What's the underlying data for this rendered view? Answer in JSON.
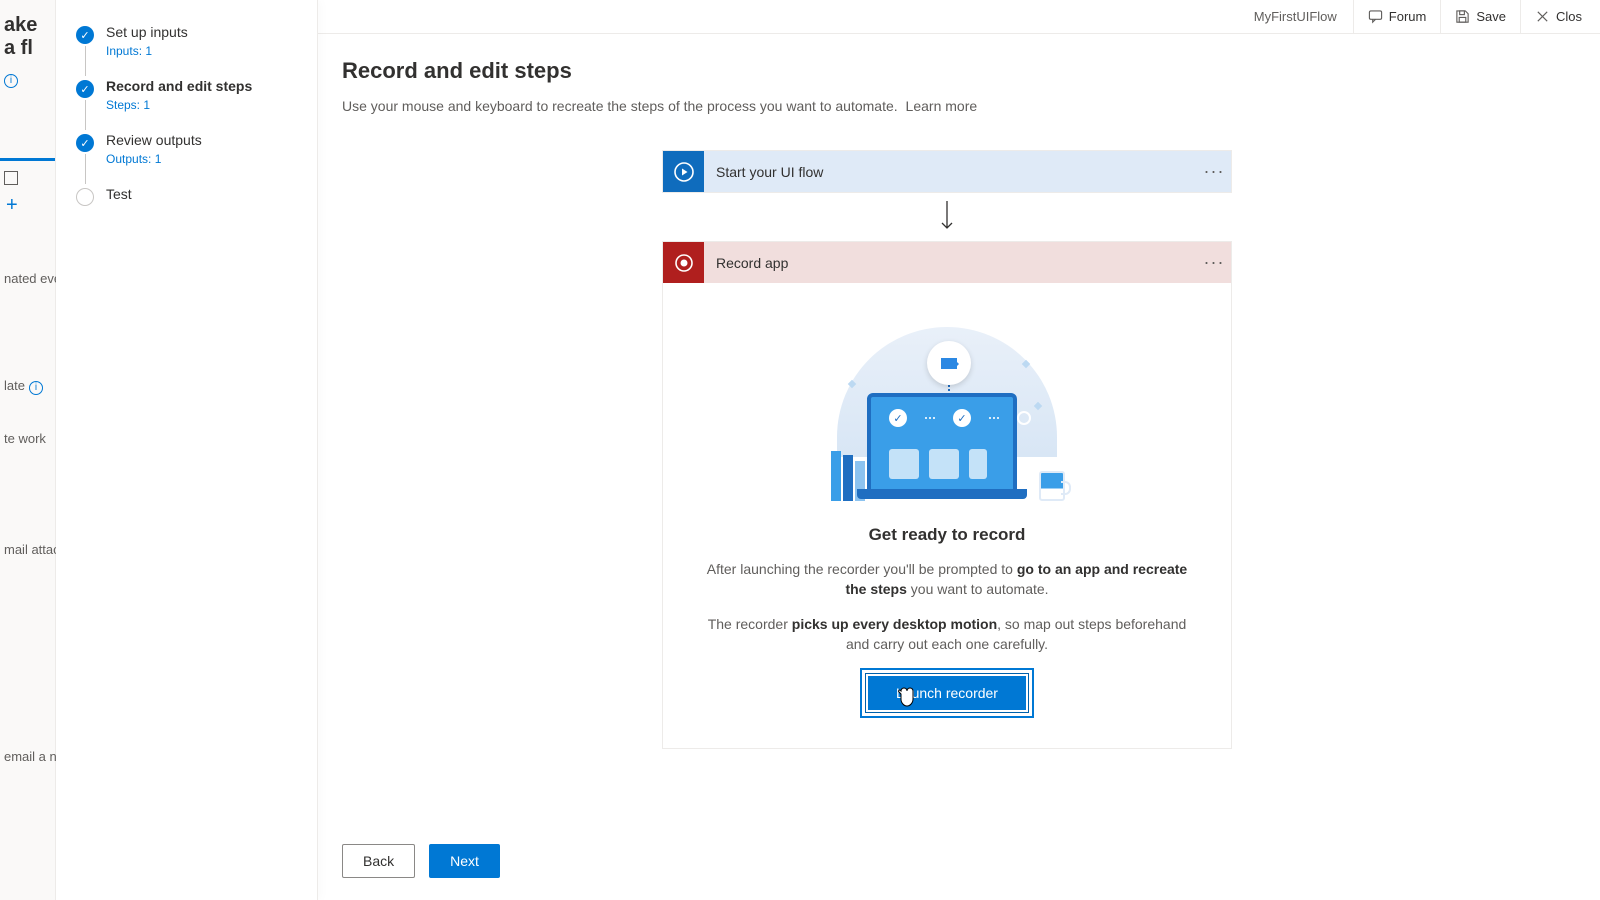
{
  "background_strip": {
    "page_title_fragment": "ake a fl",
    "fragments": [
      "nated even",
      "late",
      "te work",
      "mail attac",
      "email a n"
    ]
  },
  "header": {
    "flow_name": "MyFirstUIFlow",
    "forum": "Forum",
    "save": "Save",
    "close": "Clos"
  },
  "wizard": {
    "steps": [
      {
        "title": "Set up inputs",
        "sub": "Inputs: 1",
        "done": true
      },
      {
        "title": "Record and edit steps",
        "sub": "Steps: 1",
        "done": true,
        "active": true
      },
      {
        "title": "Review outputs",
        "sub": "Outputs: 1",
        "done": true
      },
      {
        "title": "Test",
        "sub": "",
        "done": false
      }
    ]
  },
  "main": {
    "heading": "Record and edit steps",
    "description": "Use your mouse and keyboard to recreate the steps of the process you want to automate.",
    "learn_more": "Learn more"
  },
  "flow_cards": {
    "start": {
      "title": "Start your UI flow"
    },
    "record": {
      "title": "Record app",
      "panel": {
        "heading": "Get ready to record",
        "p1_pre": "After launching the recorder you'll be prompted to ",
        "p1_bold": "go to an app and recreate the steps",
        "p1_post": " you want to automate.",
        "p2_pre": "The recorder ",
        "p2_bold": "picks up every desktop motion",
        "p2_post": ", so map out steps beforehand and carry out each one carefully.",
        "button": "Launch recorder"
      }
    }
  },
  "footer": {
    "back": "Back",
    "next": "Next"
  }
}
